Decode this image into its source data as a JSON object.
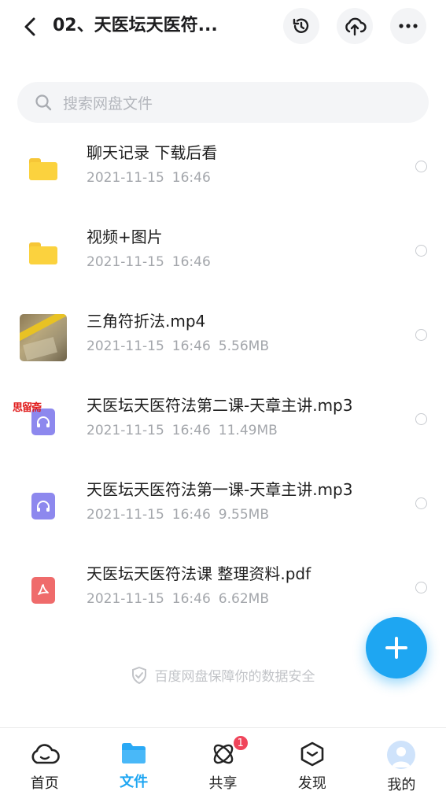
{
  "header": {
    "title": "02、天医坛天医符..."
  },
  "search": {
    "placeholder": "搜索网盘文件"
  },
  "files": [
    {
      "name": "聊天记录 下载后看",
      "date": "2021-11-15",
      "time": "16:46",
      "size": "",
      "type": "folder"
    },
    {
      "name": "视频+图片",
      "date": "2021-11-15",
      "time": "16:46",
      "size": "",
      "type": "folder"
    },
    {
      "name": "三角符折法.mp4",
      "date": "2021-11-15",
      "time": "16:46",
      "size": "5.56MB",
      "type": "video"
    },
    {
      "name": "天医坛天医符法第二课-天章主讲.mp3",
      "date": "2021-11-15",
      "time": "16:46",
      "size": "11.49MB",
      "type": "audio"
    },
    {
      "name": "天医坛天医符法第一课-天章主讲.mp3",
      "date": "2021-11-15",
      "time": "16:46",
      "size": "9.55MB",
      "type": "audio"
    },
    {
      "name": "天医坛天医符法课 整理资料.pdf",
      "date": "2021-11-15",
      "time": "16:46",
      "size": "6.62MB",
      "type": "pdf"
    }
  ],
  "watermark": "思留斋",
  "security_note": "百度网盘保障你的数据安全",
  "tabbar": {
    "items": [
      {
        "label": "首页",
        "icon": "home-cloud-icon"
      },
      {
        "label": "文件",
        "icon": "folder-icon"
      },
      {
        "label": "共享",
        "icon": "share-atom-icon",
        "badge": "1"
      },
      {
        "label": "发现",
        "icon": "discover-box-icon"
      },
      {
        "label": "我的",
        "icon": "avatar-icon"
      }
    ],
    "active": "文件"
  },
  "colors": {
    "accent": "#1ea6f2",
    "folder": "#fbd23e",
    "audio": "#8d88ee",
    "pdf": "#ef6b6b",
    "badge": "#f0455b"
  }
}
